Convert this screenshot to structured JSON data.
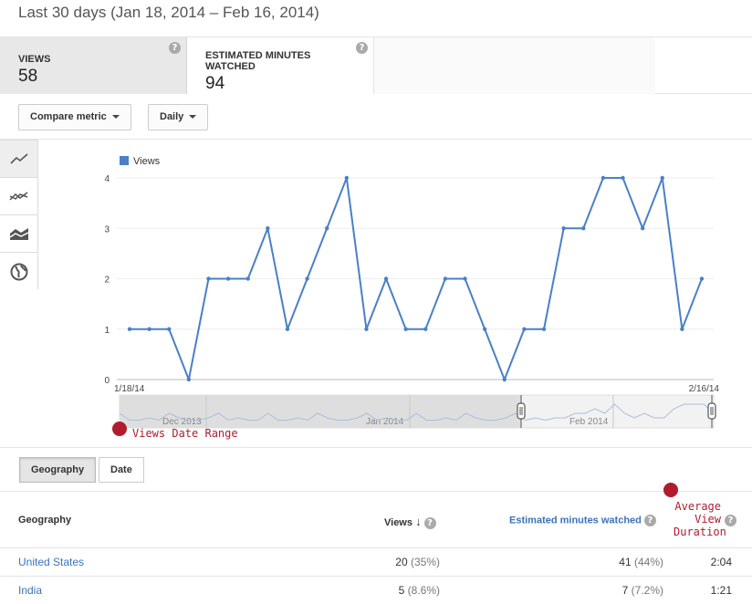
{
  "header": {
    "title": "Last 30 days (Jan 18, 2014 – Feb 16, 2014)"
  },
  "metrics": [
    {
      "label": "VIEWS",
      "value": "58",
      "selected": true
    },
    {
      "label": "ESTIMATED MINUTES WATCHED",
      "value": "94",
      "selected": false
    }
  ],
  "help_glyph": "?",
  "controls": {
    "compare_label": "Compare metric",
    "interval_label": "Daily"
  },
  "chart_tools": [
    "line-chart-icon",
    "multi-line-chart-icon",
    "stacked-area-icon",
    "globe-icon"
  ],
  "chart_data": {
    "type": "line",
    "legend": [
      "Views"
    ],
    "series": [
      {
        "name": "Views",
        "color": "#4a80c7",
        "values": [
          1,
          1,
          1,
          0,
          2,
          2,
          2,
          3,
          1,
          2,
          3,
          4,
          1,
          2,
          1,
          1,
          2,
          2,
          1,
          0,
          1,
          1,
          3,
          3,
          4,
          4,
          3,
          4,
          1,
          2
        ]
      }
    ],
    "ylim": [
      0,
      4
    ],
    "yticks": [
      "0",
      "1",
      "2",
      "3",
      "4"
    ],
    "x_start_label": "1/18/14",
    "x_end_label": "2/16/14",
    "grid": true,
    "navigator": {
      "labels": [
        "Dec 2013",
        "Jan 2014",
        "Feb 2014"
      ],
      "range_caption": "Views Date Range"
    }
  },
  "tabs": {
    "geography": "Geography",
    "date": "Date"
  },
  "table": {
    "columns": {
      "geography": "Geography",
      "views": "Views",
      "sort_glyph": "↓",
      "minutes": "Estimated minutes watched",
      "avg_duration_caption": [
        "Average",
        "View",
        "Duration"
      ]
    },
    "rows": [
      {
        "country": "United States",
        "views": "20",
        "views_pct": "(35%)",
        "minutes": "41",
        "minutes_pct": "(44%)",
        "avg": "2:04"
      },
      {
        "country": "India",
        "views": "5",
        "views_pct": "(8.6%)",
        "minutes": "7",
        "minutes_pct": "(7.2%)",
        "avg": "1:21"
      }
    ]
  },
  "colors": {
    "accent": "#4a80c7",
    "annotation": "#b01c2e",
    "link": "#3a73b8"
  }
}
